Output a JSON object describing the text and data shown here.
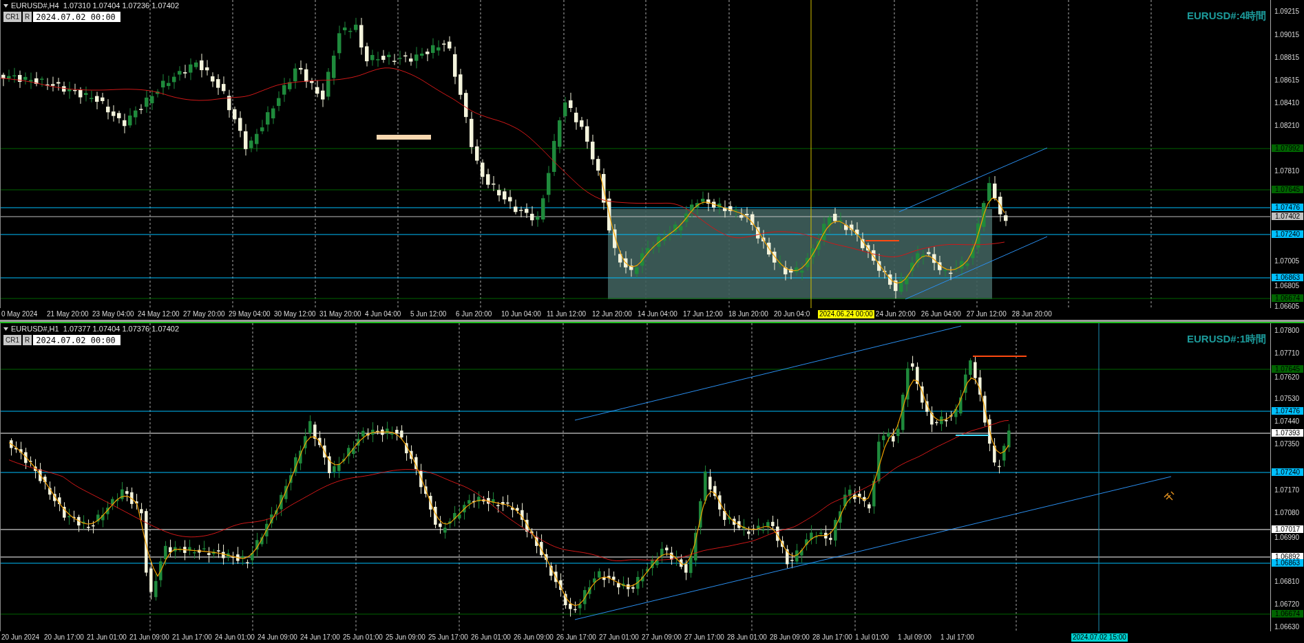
{
  "panels": [
    {
      "header": "EURUSD#,H4  1.07310 1.07404 1.07236 1.07402",
      "buttons": [
        {
          "label": "CR1"
        },
        {
          "label": "R"
        }
      ],
      "date_field": {
        "value": "2024.07.02 00:00"
      },
      "chart_label": "EURUSD#:4時間",
      "price_ticks": [
        "1.09215",
        "1.09015",
        "1.08815",
        "1.08615",
        "1.08410",
        "1.08210",
        "1.07810",
        "1.07005",
        "1.06805",
        "1.06605"
      ],
      "price_tags": [
        {
          "label": "1.07992",
          "color": "#006400"
        },
        {
          "label": "1.07645",
          "color": "#006400"
        },
        {
          "label": "1.07476",
          "color": "#00bfff"
        },
        {
          "label": "1.07402",
          "color": "#c0c0c0"
        },
        {
          "label": "1.07240",
          "color": "#00bfff"
        },
        {
          "label": "1.06863",
          "color": "#00bfff"
        },
        {
          "label": "1.06674",
          "color": "#006400"
        }
      ],
      "time_labels": [
        {
          "kind": "tick",
          "label": "0 May 2024"
        },
        {
          "kind": "tick",
          "label": "21 May 20:00"
        },
        {
          "kind": "tick",
          "label": "23 May 04:00"
        },
        {
          "kind": "tick",
          "label": "24 May 12:00"
        },
        {
          "kind": "tick",
          "label": "27 May 20:00"
        },
        {
          "kind": "tick",
          "label": "29 May 04:00"
        },
        {
          "kind": "tick",
          "label": "30 May 12:00"
        },
        {
          "kind": "tick",
          "label": "31 May 20:00"
        },
        {
          "kind": "tick",
          "label": "4 Jun 04:00"
        },
        {
          "kind": "tick",
          "label": "5 Jun 12:00"
        },
        {
          "kind": "tick",
          "label": "6 Jun 20:00"
        },
        {
          "kind": "tick",
          "label": "10 Jun 04:00"
        },
        {
          "kind": "tick",
          "label": "11 Jun 12:00"
        },
        {
          "kind": "tick",
          "label": "12 Jun 20:00"
        },
        {
          "kind": "tick",
          "label": "14 Jun 04:00"
        },
        {
          "kind": "tick",
          "label": "17 Jun 12:00"
        },
        {
          "kind": "tick",
          "label": "18 Jun 20:00"
        },
        {
          "kind": "tick",
          "label": "20 Jun 04:0"
        },
        {
          "kind": "cursor",
          "label": "2024.06.24 00:00"
        },
        {
          "kind": "tick",
          "label": "24 Jun 20:00"
        },
        {
          "kind": "tick",
          "label": "26 Jun 04:00"
        },
        {
          "kind": "tick",
          "label": "27 Jun 12:00"
        },
        {
          "kind": "tick",
          "label": "28 Jun 20:00"
        }
      ]
    },
    {
      "header": "EURUSD#,H1  1.07377 1.07404 1.07376 1.07402",
      "buttons": [
        {
          "label": "CR1"
        },
        {
          "label": "R"
        }
      ],
      "date_field": {
        "value": "2024.07.02 00:00"
      },
      "chart_label": "EURUSD#:1時間",
      "price_ticks": [
        "1.07800",
        "1.07710",
        "1.07620",
        "1.07530",
        "1.07440",
        "1.07350",
        "1.07170",
        "1.07080",
        "1.06990",
        "1.06810",
        "1.06720",
        "1.06630"
      ],
      "price_tags": [
        {
          "label": "1.07645",
          "color": "#006400"
        },
        {
          "label": "1.07476",
          "color": "#00bfff"
        },
        {
          "label": "1.07393",
          "color": "#ffffff"
        },
        {
          "label": "1.07240",
          "color": "#00bfff"
        },
        {
          "label": "1.07017",
          "color": "#ffffff"
        },
        {
          "label": "1.06892",
          "color": "#ffffff"
        },
        {
          "label": "1.06863",
          "color": "#00bfff"
        },
        {
          "label": "1.06674",
          "color": "#006400"
        }
      ],
      "time_labels": [
        {
          "kind": "tick",
          "label": "20 Jun 2024"
        },
        {
          "kind": "tick",
          "label": "20 Jun 17:00"
        },
        {
          "kind": "tick",
          "label": "21 Jun 01:00"
        },
        {
          "kind": "tick",
          "label": "21 Jun 09:00"
        },
        {
          "kind": "tick",
          "label": "21 Jun 17:00"
        },
        {
          "kind": "tick",
          "label": "24 Jun 01:00"
        },
        {
          "kind": "tick",
          "label": "24 Jun 09:00"
        },
        {
          "kind": "tick",
          "label": "24 Jun 17:00"
        },
        {
          "kind": "tick",
          "label": "25 Jun 01:00"
        },
        {
          "kind": "tick",
          "label": "25 Jun 09:00"
        },
        {
          "kind": "tick",
          "label": "25 Jun 17:00"
        },
        {
          "kind": "tick",
          "label": "26 Jun 01:00"
        },
        {
          "kind": "tick",
          "label": "26 Jun 09:00"
        },
        {
          "kind": "tick",
          "label": "26 Jun 17:00"
        },
        {
          "kind": "tick",
          "label": "27 Jun 01:00"
        },
        {
          "kind": "tick",
          "label": "27 Jun 09:00"
        },
        {
          "kind": "tick",
          "label": "27 Jun 17:00"
        },
        {
          "kind": "tick",
          "label": "28 Jun 01:00"
        },
        {
          "kind": "tick",
          "label": "28 Jun 09:00"
        },
        {
          "kind": "tick",
          "label": "28 Jun 17:00"
        },
        {
          "kind": "tick",
          "label": "1 Jul 01:00"
        },
        {
          "kind": "tick",
          "label": "1 Jul 09:00"
        },
        {
          "kind": "tick",
          "label": "1 Jul 17:00"
        },
        {
          "kind": "cursor",
          "label": "2024.07.02 15:00"
        }
      ]
    }
  ]
}
